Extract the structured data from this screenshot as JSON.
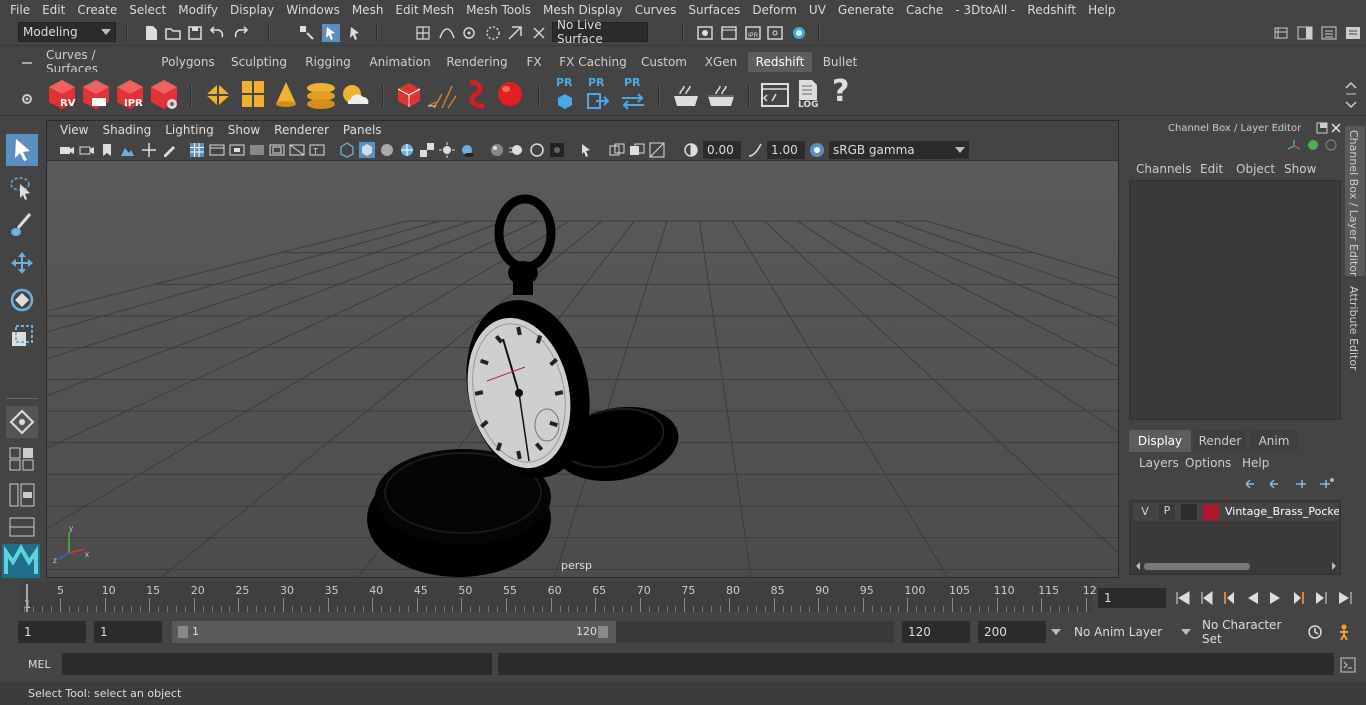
{
  "menubar": [
    "File",
    "Edit",
    "Create",
    "Select",
    "Modify",
    "Display",
    "Windows",
    "Mesh",
    "Edit Mesh",
    "Mesh Tools",
    "Mesh Display",
    "Curves",
    "Surfaces",
    "Deform",
    "UV",
    "Generate",
    "Cache",
    "- 3DtoAll -",
    "Redshift",
    "Help"
  ],
  "statusline": {
    "mode": "Modeling",
    "live_surface": "No Live Surface"
  },
  "shelf_tabs": [
    "Curves / Surfaces",
    "Polygons",
    "Sculpting",
    "Rigging",
    "Animation",
    "Rendering",
    "FX",
    "FX Caching",
    "Custom",
    "XGen",
    "Redshift",
    "Bullet"
  ],
  "shelf_active": "Redshift",
  "shelf_labels": {
    "rv": "RV",
    "ipr": "IPR",
    "pr1": "PR",
    "pr2": "PR",
    "pr3": "PR",
    "log": "LOG",
    "help": "?"
  },
  "viewport": {
    "menu": [
      "View",
      "Shading",
      "Lighting",
      "Show",
      "Renderer",
      "Panels"
    ],
    "exposure": "0.00",
    "gamma": "1.00",
    "colorspace": "sRGB gamma",
    "camera_label": "persp"
  },
  "right_panel": {
    "title": "Channel Box / Layer Editor",
    "channel_menu": [
      "Channels",
      "Edit",
      "Object",
      "Show"
    ],
    "layer_tabs": [
      "Display",
      "Render",
      "Anim"
    ],
    "layer_active": "Display",
    "layer_menu": [
      "Layers",
      "Options",
      "Help"
    ],
    "layer_row": {
      "v": "V",
      "p": "P",
      "name": "Vintage_Brass_Pocket_",
      "color": "#b0152a"
    },
    "side_tabs": [
      "Channel Box / Layer Editor",
      "Attribute Editor"
    ]
  },
  "timeline": {
    "ticks": [
      "5",
      "10",
      "15",
      "20",
      "25",
      "30",
      "35",
      "40",
      "45",
      "50",
      "55",
      "60",
      "65",
      "70",
      "75",
      "80",
      "85",
      "90",
      "95",
      "100",
      "105",
      "110",
      "115",
      "12"
    ],
    "start_label": "1",
    "current_frame": "1"
  },
  "range": {
    "start": "1",
    "playback_start": "1",
    "slider_start": "1",
    "slider_end": "120",
    "playback_end": "120",
    "end": "200",
    "anim_layer": "No Anim Layer",
    "char_set": "No Character Set"
  },
  "cmdline": {
    "lang": "MEL"
  },
  "helpline": "Select Tool: select an object"
}
